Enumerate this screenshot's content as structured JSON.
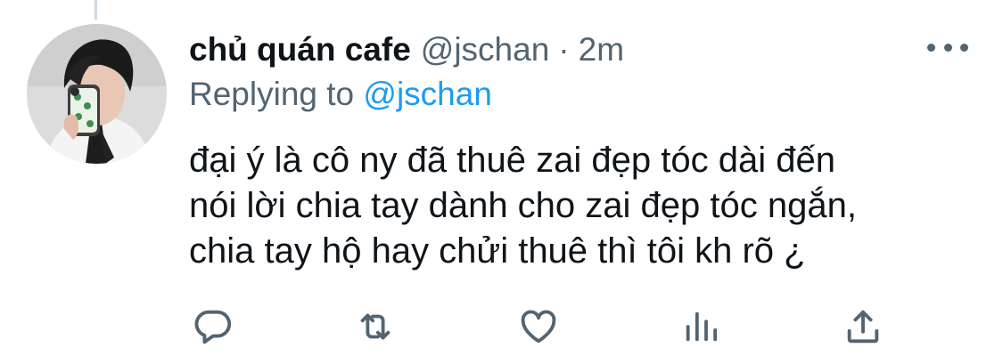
{
  "tweet": {
    "display_name": "chủ quán cafe",
    "handle": "@jschan",
    "separator": "·",
    "timestamp": "2m",
    "replying_prefix": "Replying to",
    "replying_handle": "@jschan",
    "text_lines": [
      "đại ý là cô ny đã thuê zai đẹp tóc dài đến",
      "nói lời chia tay dành cho zai đẹp tóc ngắn,",
      "chia tay hộ hay chửi thuê thì tôi kh rõ ¿"
    ]
  },
  "icons": {
    "more": "more-horizontal-icon",
    "reply": "reply-icon",
    "retweet": "retweet-icon",
    "like": "heart-icon",
    "analytics": "analytics-icon",
    "share": "share-icon"
  },
  "colors": {
    "text": "#0f1419",
    "secondary": "#536471",
    "link": "#1d9bf0",
    "thread_line": "#cfd9de"
  }
}
